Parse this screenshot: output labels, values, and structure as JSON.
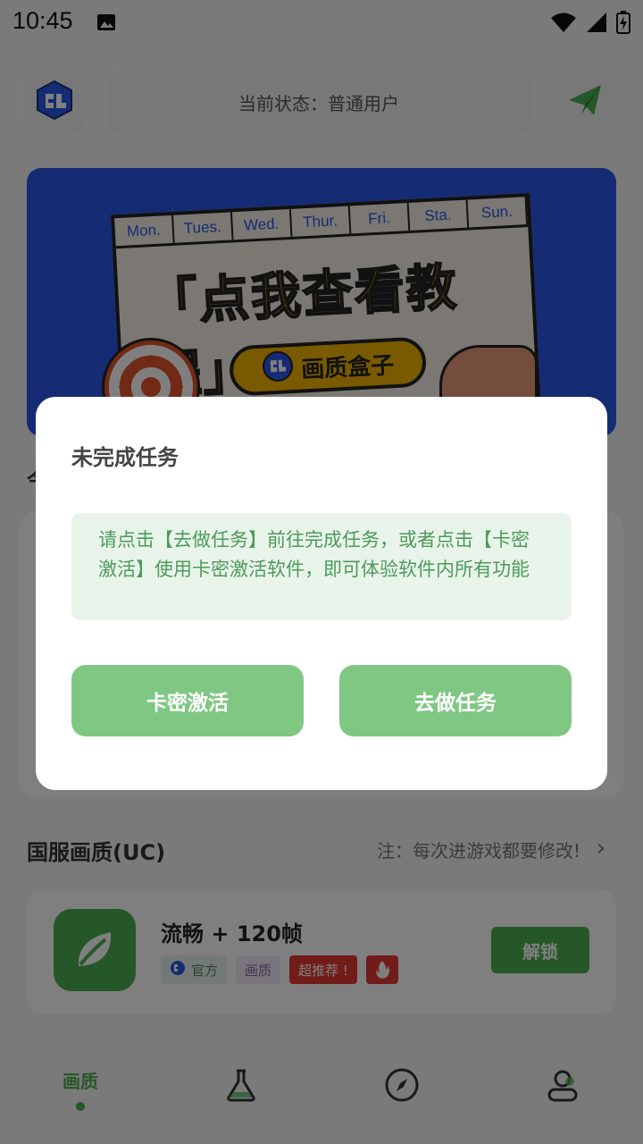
{
  "status_bar": {
    "time": "10:45"
  },
  "header": {
    "status_text": "当前状态：普通用户"
  },
  "banner": {
    "days": [
      "Mon.",
      "Tues.",
      "Wed.",
      "Thur.",
      "Fri.",
      "Sta.",
      "Sun."
    ],
    "title": "「点我查看教程」",
    "pill_text": "画质盒子"
  },
  "section_partial": {
    "title": "今"
  },
  "section": {
    "title": "国服画质(UC)",
    "note": "注：每次进游戏都要修改!"
  },
  "item": {
    "title": "流畅 + 120帧",
    "tags": {
      "official": "官方",
      "quality": "画质",
      "hot": "超推荐 !"
    },
    "unlock_label": "解锁"
  },
  "nav": {
    "items": [
      {
        "label": "画质"
      }
    ]
  },
  "dialog": {
    "title": "未完成任务",
    "message": "请点击【去做任务】前往完成任务，或者点击【卡密激活】使用卡密激活软件，即可体验软件内所有功能",
    "left_button": "卡密激活",
    "right_button": "去做任务"
  },
  "colors": {
    "accent": "#4caf50",
    "dialog_button": "#81c784",
    "banner_bg": "#2a56e8"
  }
}
